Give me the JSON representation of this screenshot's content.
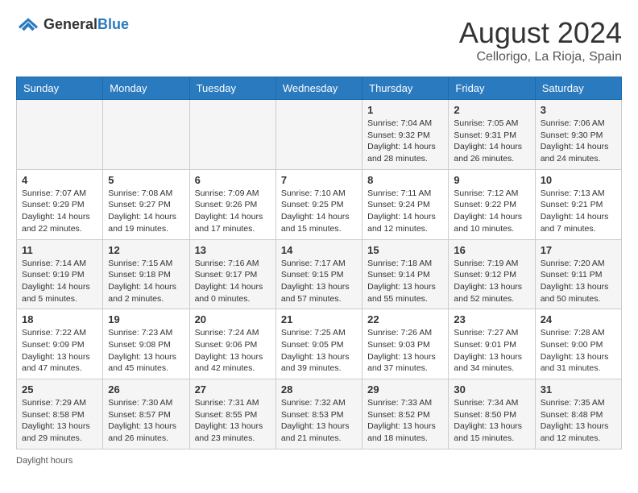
{
  "header": {
    "logo_general": "General",
    "logo_blue": "Blue",
    "title": "August 2024",
    "subtitle": "Cellorigo, La Rioja, Spain"
  },
  "days_of_week": [
    "Sunday",
    "Monday",
    "Tuesday",
    "Wednesday",
    "Thursday",
    "Friday",
    "Saturday"
  ],
  "weeks": [
    [
      {
        "day": "",
        "info": ""
      },
      {
        "day": "",
        "info": ""
      },
      {
        "day": "",
        "info": ""
      },
      {
        "day": "",
        "info": ""
      },
      {
        "day": "1",
        "info": "Sunrise: 7:04 AM\nSunset: 9:32 PM\nDaylight: 14 hours and 28 minutes."
      },
      {
        "day": "2",
        "info": "Sunrise: 7:05 AM\nSunset: 9:31 PM\nDaylight: 14 hours and 26 minutes."
      },
      {
        "day": "3",
        "info": "Sunrise: 7:06 AM\nSunset: 9:30 PM\nDaylight: 14 hours and 24 minutes."
      }
    ],
    [
      {
        "day": "4",
        "info": "Sunrise: 7:07 AM\nSunset: 9:29 PM\nDaylight: 14 hours and 22 minutes."
      },
      {
        "day": "5",
        "info": "Sunrise: 7:08 AM\nSunset: 9:27 PM\nDaylight: 14 hours and 19 minutes."
      },
      {
        "day": "6",
        "info": "Sunrise: 7:09 AM\nSunset: 9:26 PM\nDaylight: 14 hours and 17 minutes."
      },
      {
        "day": "7",
        "info": "Sunrise: 7:10 AM\nSunset: 9:25 PM\nDaylight: 14 hours and 15 minutes."
      },
      {
        "day": "8",
        "info": "Sunrise: 7:11 AM\nSunset: 9:24 PM\nDaylight: 14 hours and 12 minutes."
      },
      {
        "day": "9",
        "info": "Sunrise: 7:12 AM\nSunset: 9:22 PM\nDaylight: 14 hours and 10 minutes."
      },
      {
        "day": "10",
        "info": "Sunrise: 7:13 AM\nSunset: 9:21 PM\nDaylight: 14 hours and 7 minutes."
      }
    ],
    [
      {
        "day": "11",
        "info": "Sunrise: 7:14 AM\nSunset: 9:19 PM\nDaylight: 14 hours and 5 minutes."
      },
      {
        "day": "12",
        "info": "Sunrise: 7:15 AM\nSunset: 9:18 PM\nDaylight: 14 hours and 2 minutes."
      },
      {
        "day": "13",
        "info": "Sunrise: 7:16 AM\nSunset: 9:17 PM\nDaylight: 14 hours and 0 minutes."
      },
      {
        "day": "14",
        "info": "Sunrise: 7:17 AM\nSunset: 9:15 PM\nDaylight: 13 hours and 57 minutes."
      },
      {
        "day": "15",
        "info": "Sunrise: 7:18 AM\nSunset: 9:14 PM\nDaylight: 13 hours and 55 minutes."
      },
      {
        "day": "16",
        "info": "Sunrise: 7:19 AM\nSunset: 9:12 PM\nDaylight: 13 hours and 52 minutes."
      },
      {
        "day": "17",
        "info": "Sunrise: 7:20 AM\nSunset: 9:11 PM\nDaylight: 13 hours and 50 minutes."
      }
    ],
    [
      {
        "day": "18",
        "info": "Sunrise: 7:22 AM\nSunset: 9:09 PM\nDaylight: 13 hours and 47 minutes."
      },
      {
        "day": "19",
        "info": "Sunrise: 7:23 AM\nSunset: 9:08 PM\nDaylight: 13 hours and 45 minutes."
      },
      {
        "day": "20",
        "info": "Sunrise: 7:24 AM\nSunset: 9:06 PM\nDaylight: 13 hours and 42 minutes."
      },
      {
        "day": "21",
        "info": "Sunrise: 7:25 AM\nSunset: 9:05 PM\nDaylight: 13 hours and 39 minutes."
      },
      {
        "day": "22",
        "info": "Sunrise: 7:26 AM\nSunset: 9:03 PM\nDaylight: 13 hours and 37 minutes."
      },
      {
        "day": "23",
        "info": "Sunrise: 7:27 AM\nSunset: 9:01 PM\nDaylight: 13 hours and 34 minutes."
      },
      {
        "day": "24",
        "info": "Sunrise: 7:28 AM\nSunset: 9:00 PM\nDaylight: 13 hours and 31 minutes."
      }
    ],
    [
      {
        "day": "25",
        "info": "Sunrise: 7:29 AM\nSunset: 8:58 PM\nDaylight: 13 hours and 29 minutes."
      },
      {
        "day": "26",
        "info": "Sunrise: 7:30 AM\nSunset: 8:57 PM\nDaylight: 13 hours and 26 minutes."
      },
      {
        "day": "27",
        "info": "Sunrise: 7:31 AM\nSunset: 8:55 PM\nDaylight: 13 hours and 23 minutes."
      },
      {
        "day": "28",
        "info": "Sunrise: 7:32 AM\nSunset: 8:53 PM\nDaylight: 13 hours and 21 minutes."
      },
      {
        "day": "29",
        "info": "Sunrise: 7:33 AM\nSunset: 8:52 PM\nDaylight: 13 hours and 18 minutes."
      },
      {
        "day": "30",
        "info": "Sunrise: 7:34 AM\nSunset: 8:50 PM\nDaylight: 13 hours and 15 minutes."
      },
      {
        "day": "31",
        "info": "Sunrise: 7:35 AM\nSunset: 8:48 PM\nDaylight: 13 hours and 12 minutes."
      }
    ]
  ],
  "footer": "Daylight hours"
}
